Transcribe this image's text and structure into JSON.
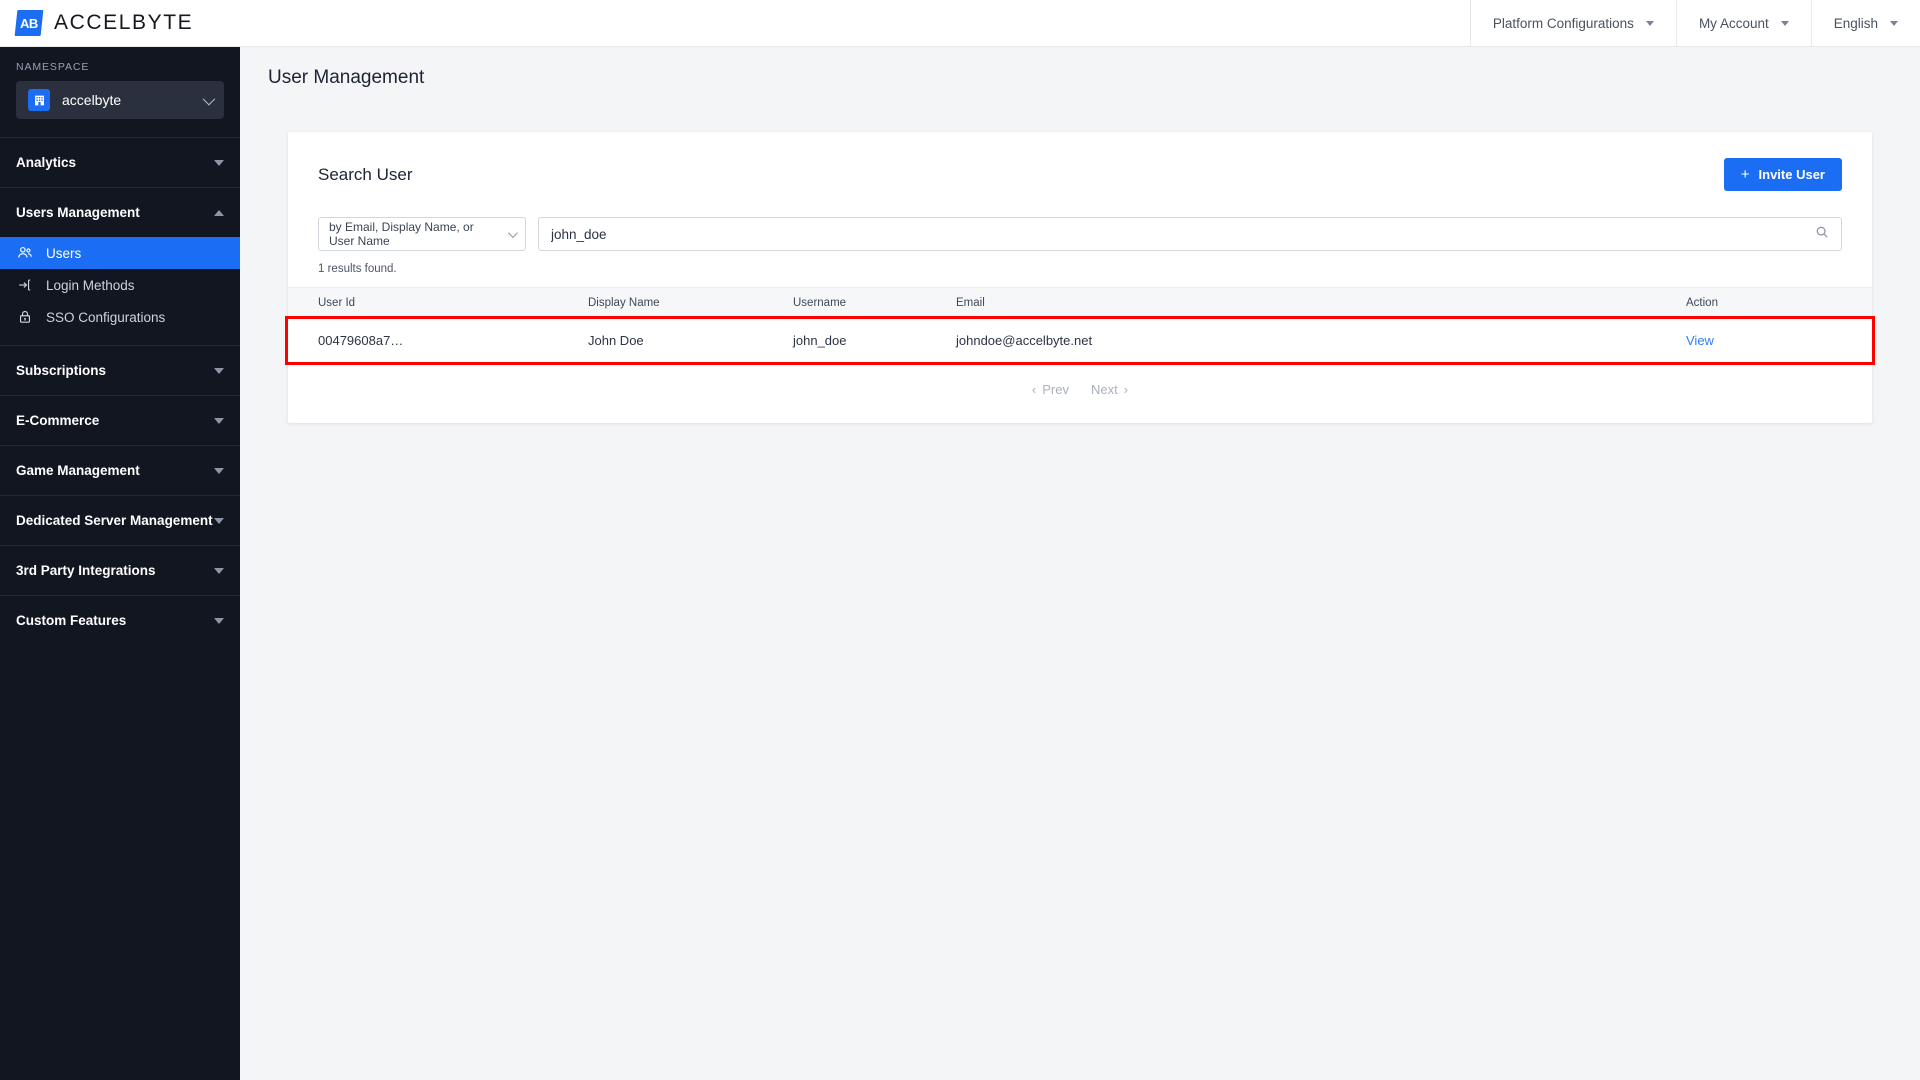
{
  "topbar": {
    "brand_mark": "AB",
    "brand_name": "ACCELBYTE",
    "menu": [
      {
        "label": "Platform Configurations",
        "icon": "chevron-down-icon"
      },
      {
        "label": "My Account",
        "icon": "chevron-down-icon"
      },
      {
        "label": "English",
        "icon": "chevron-down-icon"
      }
    ]
  },
  "sidebar": {
    "namespace_label": "NAMESPACE",
    "namespace_value": "accelbyte",
    "namespace_icon": "building-icon",
    "groups": [
      {
        "label": "Analytics",
        "expanded": false,
        "items": []
      },
      {
        "label": "Users Management",
        "expanded": true,
        "items": [
          {
            "label": "Users",
            "icon": "users-icon",
            "active": true
          },
          {
            "label": "Login Methods",
            "icon": "login-arrow-icon",
            "active": false
          },
          {
            "label": "SSO Configurations",
            "icon": "lock-icon",
            "active": false
          }
        ]
      },
      {
        "label": "Subscriptions",
        "expanded": false,
        "items": []
      },
      {
        "label": "E-Commerce",
        "expanded": false,
        "items": []
      },
      {
        "label": "Game Management",
        "expanded": false,
        "items": []
      },
      {
        "label": "Dedicated Server Management",
        "expanded": false,
        "items": []
      },
      {
        "label": "3rd Party Integrations",
        "expanded": false,
        "items": []
      },
      {
        "label": "Custom Features",
        "expanded": false,
        "items": []
      }
    ]
  },
  "page": {
    "title": "User Management"
  },
  "card": {
    "title": "Search User",
    "invite_button": "Invite User",
    "invite_icon": "plus-icon",
    "filter_select_value": "by Email, Display Name, or User Name",
    "search_value": "john_doe",
    "search_placeholder": "",
    "search_icon": "search-icon",
    "results_text": "1 results found."
  },
  "table": {
    "columns": [
      "User Id",
      "Display Name",
      "Username",
      "Email",
      "Action"
    ],
    "rows": [
      {
        "user_id": "00479608a7…",
        "display_name": "John Doe",
        "username": "john_doe",
        "email": "johndoe@accelbyte.net",
        "action": "View",
        "highlighted": true
      }
    ]
  },
  "pagination": {
    "prev": "Prev",
    "next": "Next"
  },
  "colors": {
    "accent": "#1b6ef3",
    "sidebar_bg": "#111621",
    "page_bg": "#f4f5f7",
    "link": "#2f7ef5",
    "highlight_outline": "#ff0000"
  }
}
